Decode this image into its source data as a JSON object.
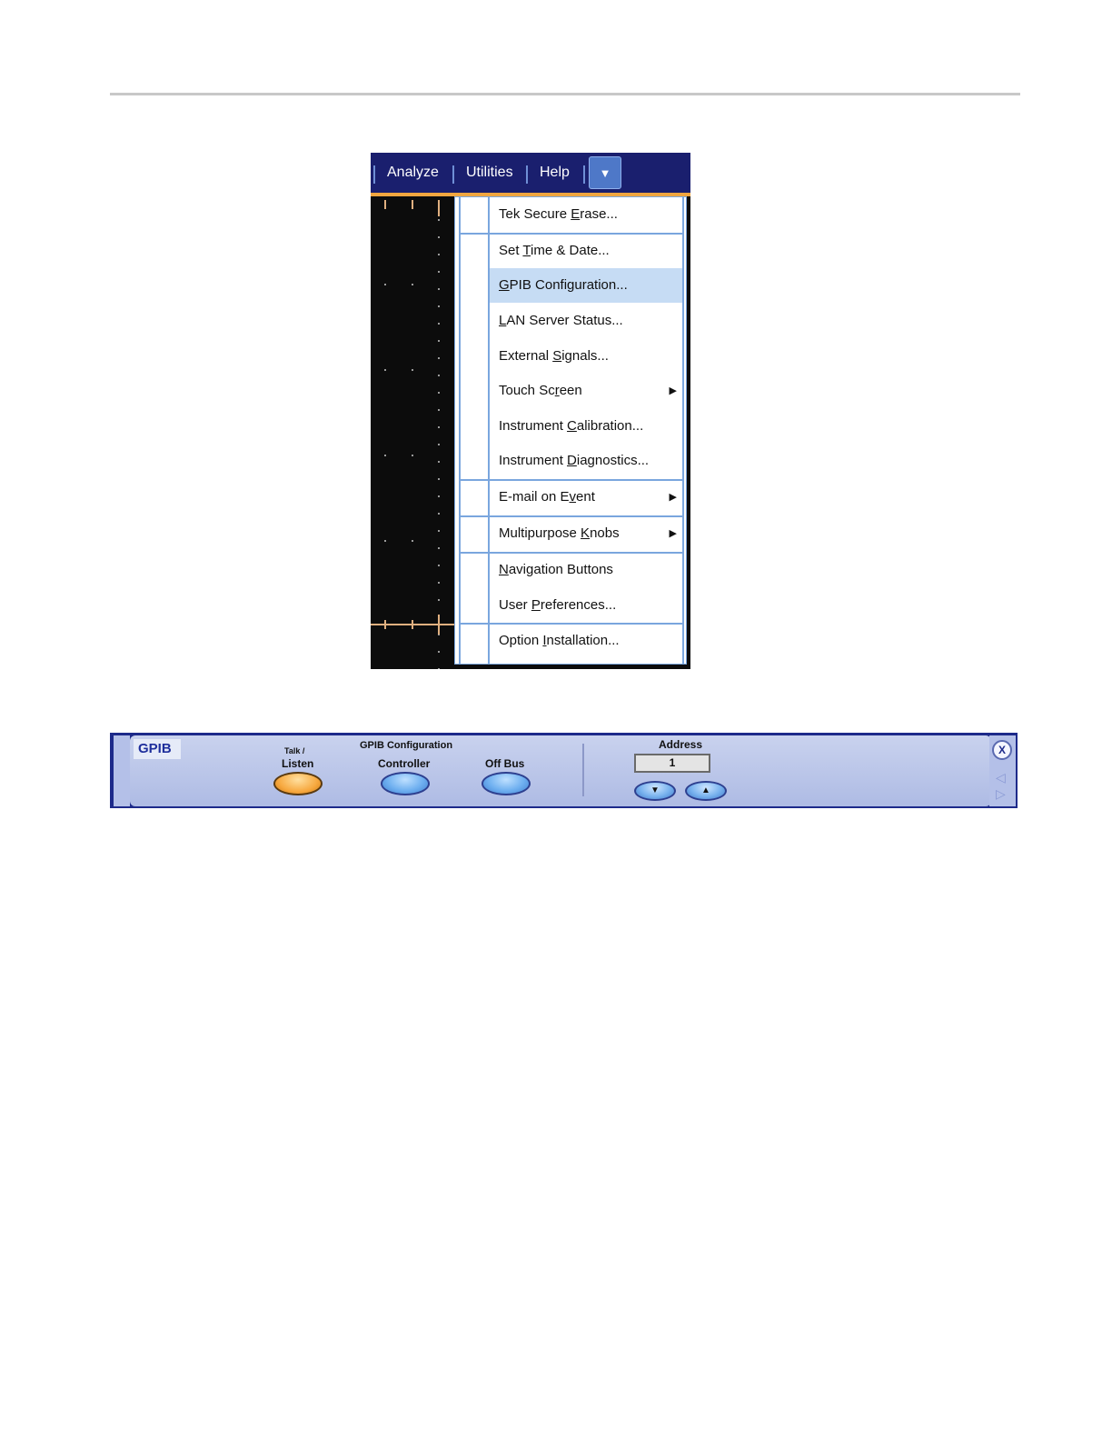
{
  "menubar": {
    "items": [
      "Analyze",
      "Utilities",
      "Help"
    ],
    "dropdown_button_icon": "chevron-down-icon"
  },
  "utilities_menu": {
    "items": [
      {
        "label": "Tek Secure Erase...",
        "underline": "E"
      },
      {
        "label": "Set Time & Date...",
        "underline": "T"
      },
      {
        "label": "GPIB Configuration...",
        "underline": "G",
        "highlighted": true
      },
      {
        "label": "LAN Server Status...",
        "underline": "L"
      },
      {
        "label": "External Signals...",
        "underline": "S"
      },
      {
        "label": "Touch Screen",
        "underline": "r",
        "submenu": true
      },
      {
        "label": "Instrument Calibration...",
        "underline": "C"
      },
      {
        "label": "Instrument Diagnostics...",
        "underline": "D"
      },
      {
        "label": "E-mail on Event",
        "underline": "v",
        "submenu": true
      },
      {
        "label": "Multipurpose Knobs",
        "underline": "K",
        "submenu": true
      },
      {
        "label": "Navigation Buttons",
        "underline": "N"
      },
      {
        "label": "User Preferences...",
        "underline": "P"
      },
      {
        "label": "Option Installation...",
        "underline": "I"
      }
    ]
  },
  "gpib_panel": {
    "tab_label": "GPIB",
    "group_title": "GPIB Configuration",
    "talk_listen_top": "Talk /",
    "talk_listen_label": "Listen",
    "controller_label": "Controller",
    "off_bus_label": "Off Bus",
    "address_label": "Address",
    "address_value": "1",
    "close_label": "X",
    "selected_mode": "Listen"
  },
  "colors": {
    "menubar": "#1a1f6e",
    "menu_highlight": "#c6dcf4",
    "panel_frame": "#1d2a8a",
    "selected_button": "#f7a940",
    "button": "#6fb0f0"
  }
}
